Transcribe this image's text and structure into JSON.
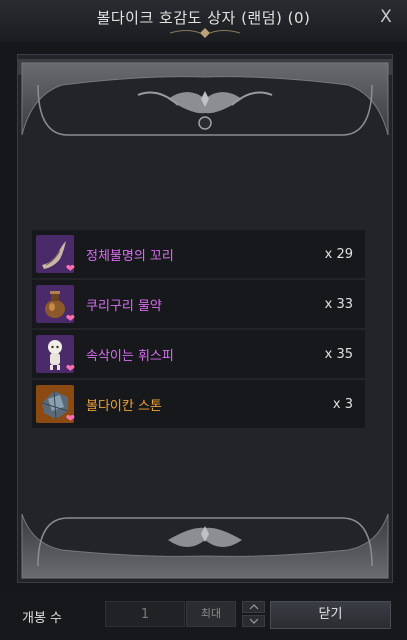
{
  "window": {
    "title": "볼다이크 호감도 상자 (랜덤) (0)",
    "close_label": "X"
  },
  "items": [
    {
      "name": "정체불명의 꼬리",
      "qty": "x 29",
      "color": "#d76ef0",
      "icon": "tail-icon"
    },
    {
      "name": "쿠리구리 물약",
      "qty": "x 33",
      "color": "#d76ef0",
      "icon": "potion-icon"
    },
    {
      "name": "속삭이는 휘스피",
      "qty": "x 35",
      "color": "#d76ef0",
      "icon": "whispy-icon"
    },
    {
      "name": "볼다이칸 스톤",
      "qty": "x 3",
      "color": "#f0a23a",
      "icon": "stone-icon"
    }
  ],
  "footer": {
    "open_label": "개봉 수",
    "quantity_value": "1",
    "max_label": "최대",
    "close_label": "닫기"
  },
  "colors": {
    "epic": "#d76ef0",
    "legendary": "#f0a23a",
    "affinity_heart": "#ff6fb4"
  }
}
